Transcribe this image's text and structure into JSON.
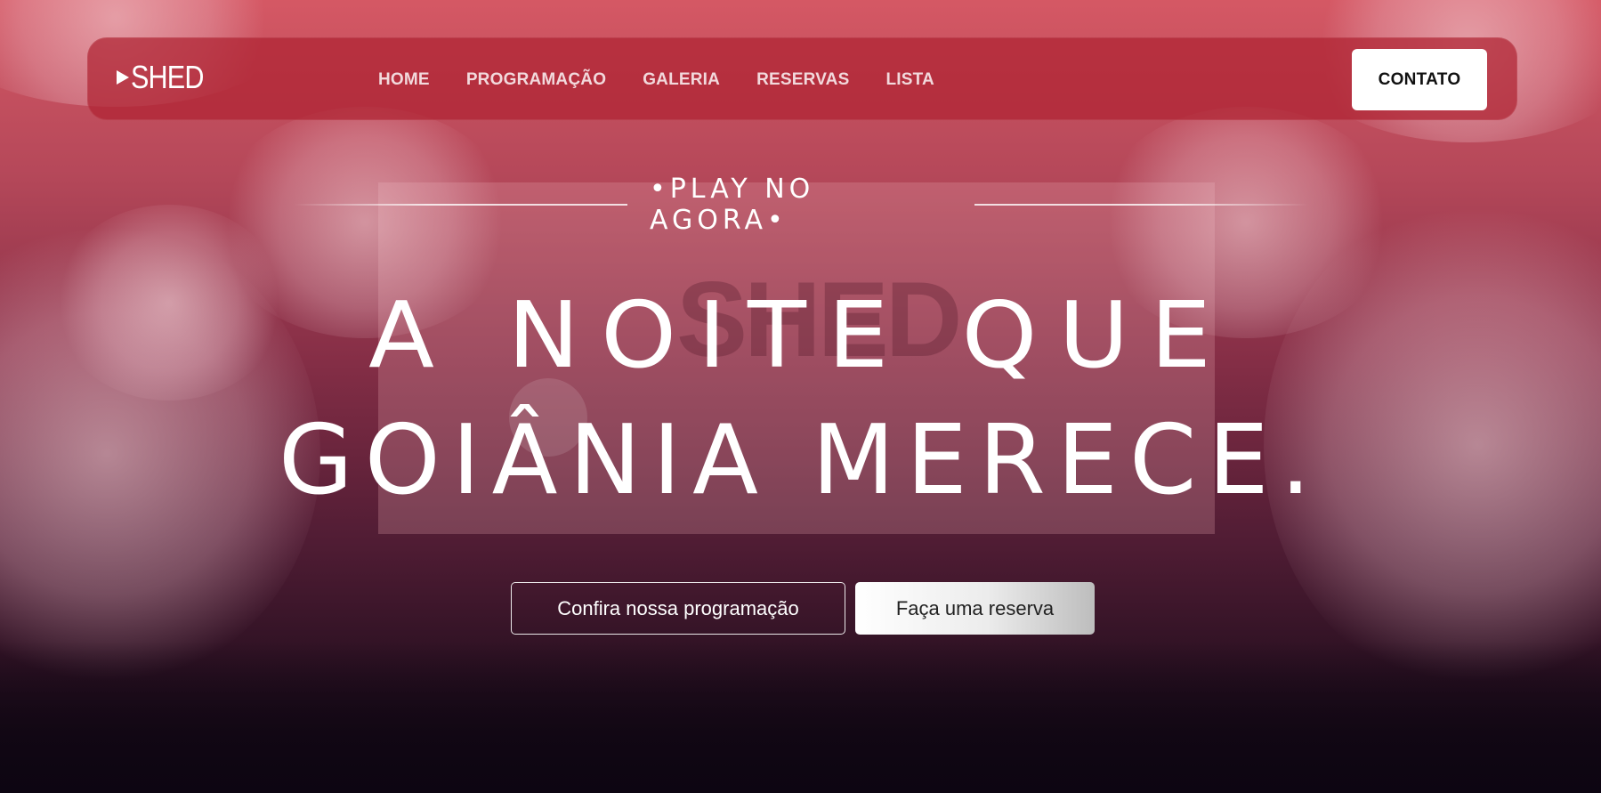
{
  "brand": {
    "logo_text": "SHED",
    "logo_icon": "play-icon"
  },
  "nav": {
    "items": [
      {
        "label": "HOME"
      },
      {
        "label": "PROGRAMAÇÃO"
      },
      {
        "label": "GALERIA"
      },
      {
        "label": "RESERVAS"
      },
      {
        "label": "LISTA"
      }
    ],
    "contact_label": "CONTATO"
  },
  "hero": {
    "tagline": "•PLAY NO AGORA•",
    "headline_line1": "A NOITE QUE",
    "headline_line2": "GOIÂNIA MERECE.",
    "cta_primary": "Confira nossa programação",
    "cta_secondary": "Faça uma reserva"
  },
  "colors": {
    "navbar_bg": "#af2332",
    "hero_top": "#de5c68",
    "hero_bottom": "#120716",
    "button_white": "#ffffff"
  }
}
